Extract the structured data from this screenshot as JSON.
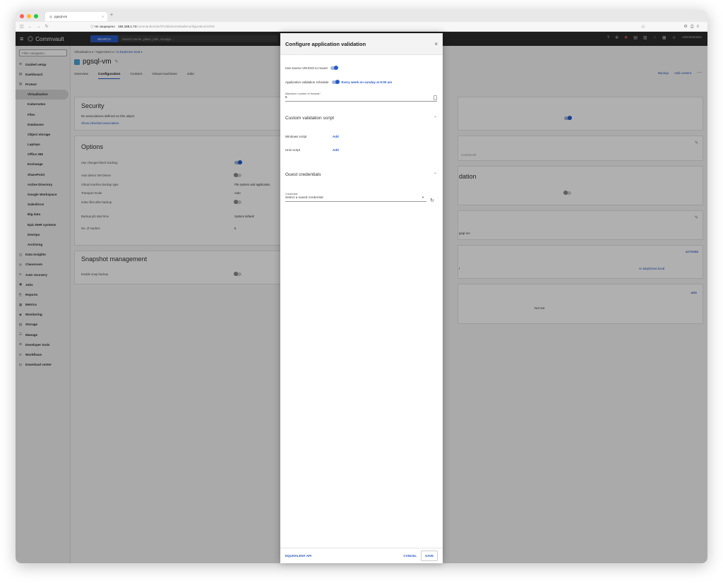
{
  "browser": {
    "tab_title": "pgsql-vm",
    "tab_close": "×",
    "new_tab": "+",
    "insecure_label": "Не защищено",
    "url_host": "192.168.1.74",
    "url_path": "/commandcenter/#/collectionDetails/configuration/10/19"
  },
  "header": {
    "menu_glyph": "≡",
    "logo_text": "Commvault",
    "search_button": "SEARCH",
    "search_placeholder": "Search server, plans, jobs, storage...",
    "user": "Administrator"
  },
  "sidebar": {
    "filter_placeholder": "Filter navigation...",
    "items": [
      {
        "label": "Guided setup",
        "icon": "gear-icon",
        "glyph": "⚙",
        "sub": false
      },
      {
        "label": "Dashboard",
        "icon": "dashboard-icon",
        "glyph": "▤",
        "sub": false
      },
      {
        "label": "Protect",
        "icon": "protect-icon",
        "glyph": "▥",
        "sub": false
      },
      {
        "label": "Virtualization",
        "sub": true,
        "selected": true
      },
      {
        "label": "Kubernetes",
        "sub": true
      },
      {
        "label": "Files",
        "sub": true
      },
      {
        "label": "Databases",
        "sub": true
      },
      {
        "label": "Object storage",
        "sub": true
      },
      {
        "label": "Laptops",
        "sub": true
      },
      {
        "label": "Office 365",
        "sub": true
      },
      {
        "label": "Exchange",
        "sub": true
      },
      {
        "label": "SharePoint",
        "sub": true
      },
      {
        "label": "Active Directory",
        "sub": true
      },
      {
        "label": "Google Workspace",
        "sub": true
      },
      {
        "label": "Salesforce",
        "sub": true
      },
      {
        "label": "Big data",
        "sub": true
      },
      {
        "label": "Epic EHR systems",
        "sub": true
      },
      {
        "label": "DevOps",
        "sub": true
      },
      {
        "label": "Archiving",
        "sub": true
      },
      {
        "label": "Data Insights",
        "icon": "insights-icon",
        "glyph": "◫",
        "sub": false
      },
      {
        "label": "Cleanroom",
        "icon": "cleanroom-icon",
        "glyph": "◎",
        "sub": false
      },
      {
        "label": "Auto recovery",
        "icon": "recovery-icon",
        "glyph": "↻",
        "sub": false
      },
      {
        "label": "Jobs",
        "icon": "jobs-icon",
        "glyph": "▣",
        "sub": false
      },
      {
        "label": "Reports",
        "icon": "reports-icon",
        "glyph": "⎘",
        "sub": false
      },
      {
        "label": "Metrics",
        "icon": "metrics-icon",
        "glyph": "▦",
        "sub": false
      },
      {
        "label": "Monitoring",
        "icon": "monitoring-icon",
        "glyph": "◉",
        "sub": false
      },
      {
        "label": "Storage",
        "icon": "storage-icon",
        "glyph": "▤",
        "sub": false
      },
      {
        "label": "Manage",
        "icon": "manage-icon",
        "glyph": "☰",
        "sub": false
      },
      {
        "label": "Developer tools",
        "icon": "devtools-icon",
        "glyph": "⚙",
        "sub": false
      },
      {
        "label": "Workflows",
        "icon": "workflows-icon",
        "glyph": "⟳",
        "sub": false
      },
      {
        "label": "Download center",
        "icon": "download-icon",
        "glyph": "⊡",
        "sub": false
      }
    ]
  },
  "page": {
    "breadcrumb": {
      "b1": "Virtualization ▾",
      "sep": "/",
      "b2": "Hypervisors ▾",
      "b3": "vc.karphome.local ▾"
    },
    "title": "pgsql-vm",
    "tabs": [
      "Overview",
      "Configuration",
      "Content",
      "Virtual machines",
      "Jobs"
    ],
    "actions": {
      "backup": "Backup",
      "add_content": "Add content",
      "more": "⋯"
    },
    "security": {
      "title": "Security",
      "text": "No associations defined on this object",
      "link": "Show inherited association"
    },
    "options": {
      "title": "Options",
      "rows": [
        {
          "label": "Use changed block tracking",
          "value": ""
        },
        {
          "label": "Auto detect VM Owner",
          "value": ""
        },
        {
          "label": "Virtual machine backup type",
          "value": "File system and application"
        },
        {
          "label": "Transport mode",
          "value": "Auto"
        },
        {
          "label": "Index files after backup",
          "value": ""
        },
        {
          "label": "Backup job start time",
          "value": "System default"
        },
        {
          "label": "No. of readers",
          "value": "5"
        }
      ]
    },
    "snapshot": {
      "title": "Snapshot management",
      "row": "Enable snap backup"
    },
    "right_cards": {
      "commcell": "CommCell",
      "validation_title": "dation",
      "vm_name": "gsql-vm",
      "actions_label": "ACTIONS",
      "hypervisor_partial": "r",
      "hypervisor_value": "vc.karphome.local",
      "add_label": "ADD",
      "not_set": "Not set"
    }
  },
  "dialog": {
    "title": "Configure application validation",
    "close": "×",
    "use_source_esx": "Use source VM ESX to mount",
    "schedule_label": "Application validation schedule",
    "schedule_value": "Every week on sunday at 9:00 am",
    "threads_label": "Maximum number of threads*",
    "threads_value": "5",
    "custom_script_title": "Custom validation script",
    "windows_script": "Windows script",
    "unix_script": "Unix script",
    "add_label": "Add",
    "guest_credentials_title": "Guest credentials",
    "credential_label": "Credential",
    "credential_placeholder": "Select a saved credential",
    "footer": {
      "api": "EQUIVALENT API",
      "cancel": "CANCEL",
      "save": "SAVE"
    }
  }
}
